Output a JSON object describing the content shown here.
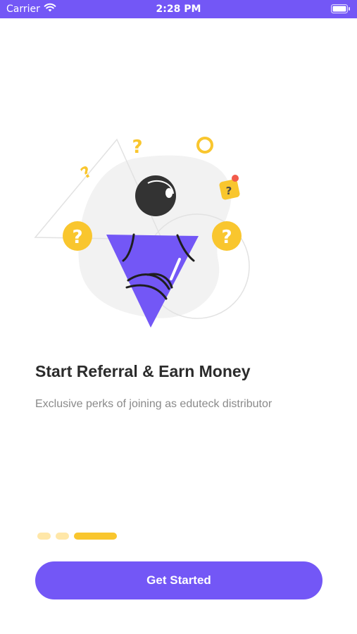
{
  "status_bar": {
    "carrier": "Carrier",
    "time": "2:28 PM"
  },
  "illustration": {
    "icons": [
      "question-mark-icon",
      "ring-icon",
      "speech-bubble-question-icon",
      "ball-icon",
      "cone-icon"
    ]
  },
  "onboarding": {
    "title": "Start Referral & Earn Money",
    "subtitle": "Exclusive perks of joining as eduteck distributor"
  },
  "pager": {
    "current_page": 3,
    "total_pages": 3
  },
  "cta": {
    "label": "Get Started"
  },
  "colors": {
    "primary": "#7357f6",
    "accent": "#f9c62e",
    "accent_light": "#ffe7a8",
    "text": "#2b2b2b",
    "muted": "#8a8a8a"
  }
}
